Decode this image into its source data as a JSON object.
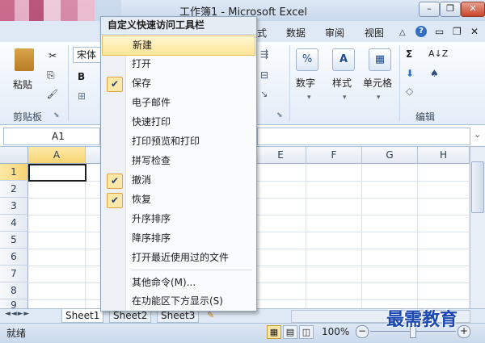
{
  "window": {
    "title": "工作簿1 - Microsoft Excel",
    "minimize": "–",
    "restore": "❐",
    "close": "✕"
  },
  "ribbon_tabs": {
    "format": "式",
    "data": "数据",
    "review": "审阅",
    "view": "视图"
  },
  "ribbon_right": {
    "help": "?",
    "min": "▭",
    "restore": "❐",
    "close": "✕",
    "arrow": "△"
  },
  "clipboard": {
    "paste": "粘贴",
    "group_label": "剪贴板",
    "cut": "✂",
    "copy": "⎘",
    "painter": "🖌"
  },
  "font": {
    "name": "宋体",
    "bold": "B",
    "border": "⊞"
  },
  "number": {
    "label": "数字",
    "icon": "%"
  },
  "styles": {
    "label": "样式",
    "icon": "A"
  },
  "cells": {
    "label": "单元格",
    "icon": "▦"
  },
  "editing": {
    "label": "编辑",
    "sum": "Σ",
    "sort": "A↓Z",
    "fill": "⬇",
    "find": "♠",
    "clear": "◇"
  },
  "formula_bar": {
    "cell_ref": "A1"
  },
  "grid": {
    "columns": [
      "A",
      "E",
      "F",
      "G",
      "H"
    ],
    "rows": [
      "1",
      "2",
      "3",
      "4",
      "5",
      "6",
      "7",
      "8",
      "9"
    ]
  },
  "sheets": {
    "nav": "◄ ◄ ► ►",
    "tabs": [
      "Sheet1",
      "Sheet2",
      "Sheet3"
    ]
  },
  "status": {
    "ready": "就绪",
    "zoom": "100%",
    "zoom_out": "−",
    "zoom_in": "+"
  },
  "menu": {
    "header": "自定义快速访问工具栏",
    "items": [
      {
        "label": "新建",
        "checked": false,
        "highlighted": true
      },
      {
        "label": "打开",
        "checked": false
      },
      {
        "label": "保存",
        "checked": true
      },
      {
        "label": "电子邮件",
        "checked": false
      },
      {
        "label": "快速打印",
        "checked": false
      },
      {
        "label": "打印预览和打印",
        "checked": false
      },
      {
        "label": "拼写检查",
        "checked": false
      },
      {
        "label": "撤消",
        "checked": true
      },
      {
        "label": "恢复",
        "checked": true
      },
      {
        "label": "升序排序",
        "checked": false
      },
      {
        "label": "降序排序",
        "checked": false
      },
      {
        "label": "打开最近使用过的文件",
        "checked": false
      },
      {
        "label": "其他命令(M)...",
        "checked": false
      },
      {
        "label": "在功能区下方显示(S)",
        "checked": false
      }
    ],
    "check_glyph": "✔"
  },
  "watermark": "最需教育",
  "colors": {
    "accent": "#1a47b0",
    "highlight": "#ffe596",
    "check_bg": "#fde8a8"
  }
}
